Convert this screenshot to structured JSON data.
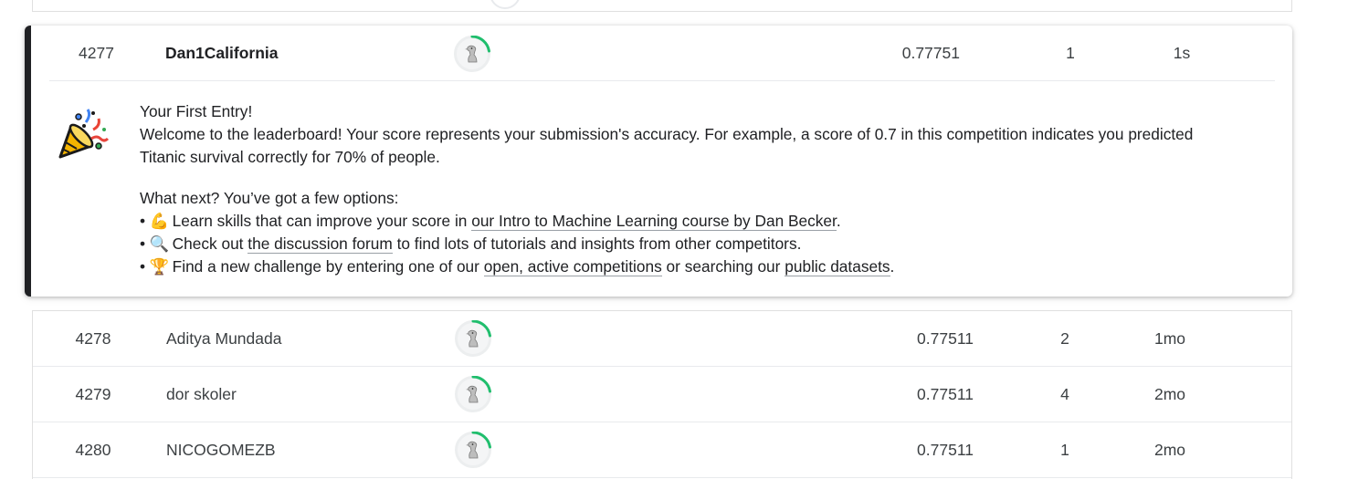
{
  "current_entry": {
    "rank": "4277",
    "team": "Dan1California",
    "score": "0.77751",
    "entries": "1",
    "last": "1s"
  },
  "message": {
    "title": "Your First Entry!",
    "welcome": "Welcome to the leaderboard! Your score represents your submission's accuracy. For example, a score of 0.7 in this competition indicates you predicted Titanic survival correctly for 70% of people.",
    "next_intro": "What next? You’ve got a few options:",
    "opt1_pre": "Learn skills that can improve your score in ",
    "opt1_link": "our Intro to Machine Learning course by Dan Becker",
    "opt1_post": ".",
    "opt2_pre": "Check out ",
    "opt2_link": "the discussion forum",
    "opt2_post": " to find lots of tutorials and insights from other competitors.",
    "opt3_pre": "Find a new challenge by entering one of our ",
    "opt3_link": "open, active competitions",
    "opt3_mid": " or searching our ",
    "opt3_link2": "public datasets",
    "opt3_post": ".",
    "icons": {
      "opt1": "flexed-biceps-icon",
      "opt2": "magnifying-glass-icon",
      "opt3": "trophy-icon",
      "header": "party-popper-icon"
    }
  },
  "rows": [
    {
      "rank": "4278",
      "team": "Aditya Mundada",
      "score": "0.77511",
      "entries": "2",
      "last": "1mo"
    },
    {
      "rank": "4279",
      "team": "dor skoler",
      "score": "0.77511",
      "entries": "4",
      "last": "2mo"
    },
    {
      "rank": "4280",
      "team": "NICOGOMEZB",
      "score": "0.77511",
      "entries": "1",
      "last": "2mo"
    }
  ],
  "colors": {
    "progress_ring": "#20BE6D",
    "highlight_bar": "#202124",
    "divider": "#E8EAED"
  }
}
